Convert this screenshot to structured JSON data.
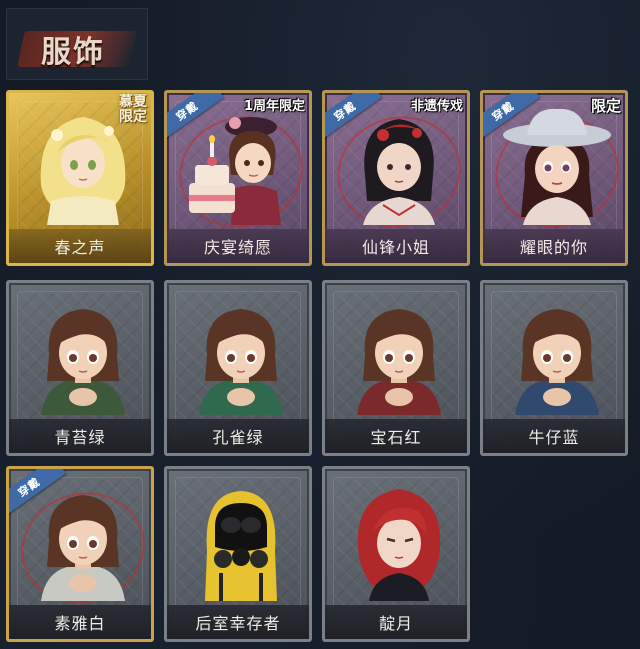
{
  "header": {
    "title": "服饰"
  },
  "cards": [
    {
      "name": "春之声",
      "style": "gold",
      "tag": "慕夏\n限定",
      "tag_type": "summer",
      "equipped": false,
      "character": "blonde-girl"
    },
    {
      "name": "庆宴绮愿",
      "style": "purple",
      "tag": "1周年限定",
      "tag_type": "anniv",
      "equipped": true,
      "character": "cake-girl"
    },
    {
      "name": "仙锋小姐",
      "style": "purple",
      "tag": "非遗传戏",
      "tag_type": "heritage",
      "equipped": true,
      "character": "opera-girl"
    },
    {
      "name": "耀眼的你",
      "style": "purple",
      "tag": "限定",
      "tag_type": "limited",
      "equipped": true,
      "character": "cowboy-girl"
    },
    {
      "name": "青苔绿",
      "style": "grey",
      "tag": "",
      "equipped": false,
      "character": "brown-girl",
      "color": "#3c5a3a"
    },
    {
      "name": "孔雀绿",
      "style": "grey",
      "tag": "",
      "equipped": false,
      "character": "brown-girl",
      "color": "#2f6a4e"
    },
    {
      "name": "宝石红",
      "style": "grey",
      "tag": "",
      "equipped": false,
      "character": "brown-girl",
      "color": "#7a2a2a"
    },
    {
      "name": "牛仔蓝",
      "style": "grey",
      "tag": "",
      "equipped": false,
      "character": "brown-girl",
      "color": "#2f4a6e"
    },
    {
      "name": "素雅白",
      "style": "grey",
      "tag": "",
      "equipped": true,
      "character": "brown-girl",
      "color": "#c9c9c4",
      "selected": true
    },
    {
      "name": "后室幸存者",
      "style": "grey",
      "tag": "",
      "equipped": false,
      "character": "hazmat"
    },
    {
      "name": "靛月",
      "style": "grey",
      "tag": "",
      "equipped": false,
      "character": "red-hair"
    }
  ],
  "labels": {
    "equipped": "穿戴"
  },
  "colors": {
    "background": "#141b26",
    "gold": "#d9b54a",
    "ribbon": "#3e6aa8"
  }
}
